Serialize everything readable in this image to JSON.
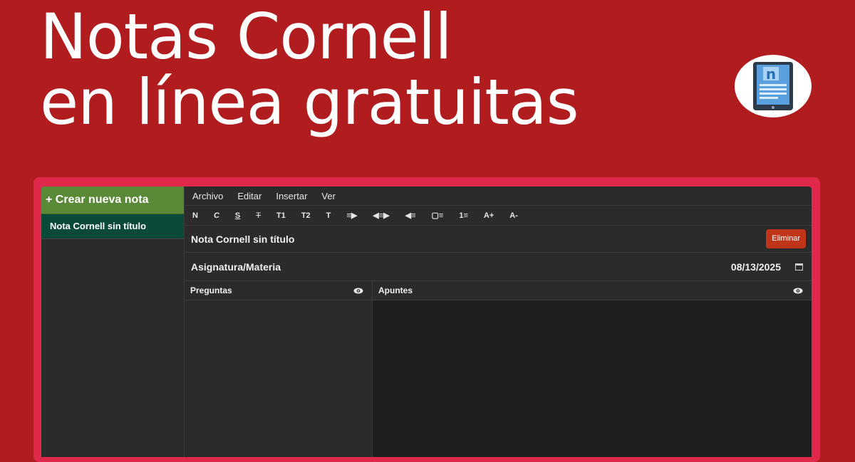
{
  "hero": {
    "line1": "Notas Cornell",
    "line2": "en línea gratuitas"
  },
  "logo": {
    "icon": "notebook-tablet-icon",
    "letter": "n"
  },
  "sidebar": {
    "new_note_label": "+ Crear nueva nota",
    "items": [
      {
        "label": "Nota Cornell sin título"
      }
    ]
  },
  "menu": {
    "items": [
      "Archivo",
      "Editar",
      "Insertar",
      "Ver"
    ]
  },
  "toolbar": {
    "buttons": [
      "N",
      "C",
      "S",
      "T",
      "T1",
      "T2",
      "T",
      "≡▶",
      "◀≡▶",
      "◀≡",
      "▢≡",
      "1≡",
      "A+",
      "A-"
    ]
  },
  "note": {
    "title": "Nota Cornell sin título",
    "delete_label": "Eliminar",
    "subject": "Asignatura/Materia",
    "date": "08/13/2025"
  },
  "columns": {
    "questions": "Preguntas",
    "notes": "Apuntes"
  },
  "colors": {
    "background": "#b11c1e",
    "frame": "#e0294a",
    "accent": "#5a8a37",
    "selected": "#0b4a3a",
    "danger": "#c0351a"
  }
}
